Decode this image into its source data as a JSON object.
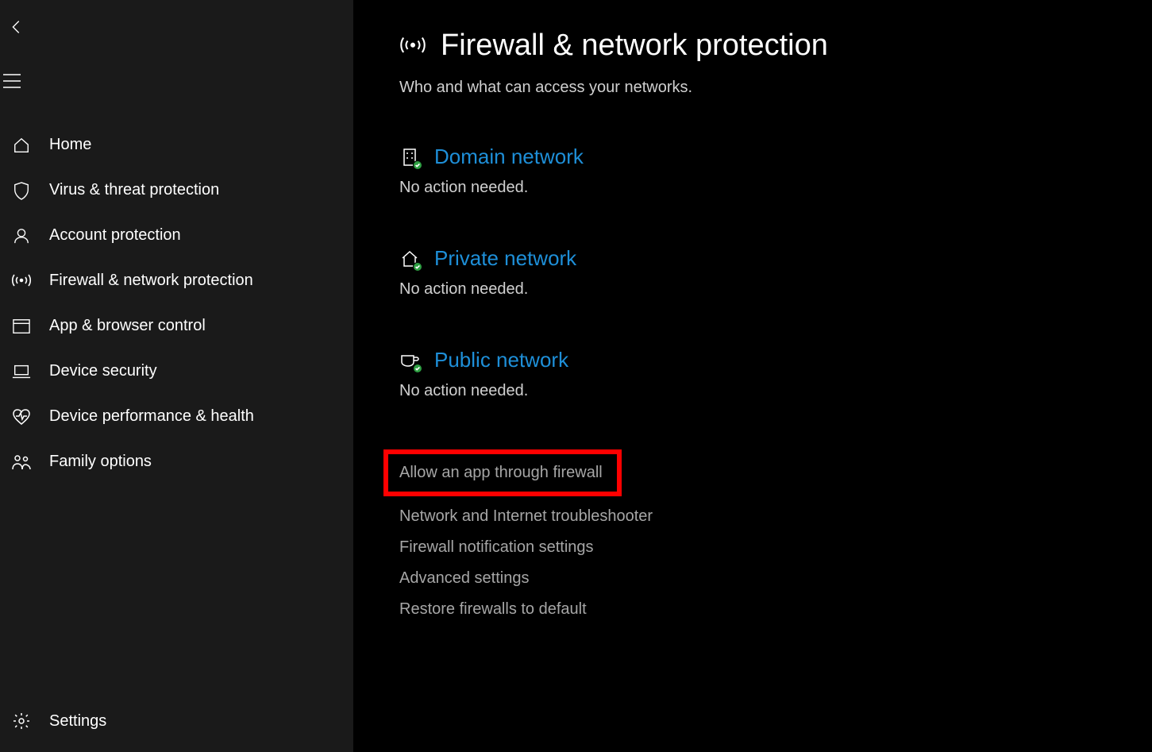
{
  "sidebar": {
    "items": [
      {
        "label": "Home"
      },
      {
        "label": "Virus & threat protection"
      },
      {
        "label": "Account protection"
      },
      {
        "label": "Firewall & network protection"
      },
      {
        "label": "App & browser control"
      },
      {
        "label": "Device security"
      },
      {
        "label": "Device performance & health"
      },
      {
        "label": "Family options"
      }
    ],
    "settings_label": "Settings"
  },
  "page": {
    "title": "Firewall & network protection",
    "subtitle": "Who and what can access your networks."
  },
  "networks": [
    {
      "name": "Domain network",
      "status": "No action needed."
    },
    {
      "name": "Private network",
      "status": "No action needed."
    },
    {
      "name": "Public network",
      "status": "No action needed."
    }
  ],
  "actions": {
    "allow_app": "Allow an app through firewall",
    "troubleshooter": "Network and Internet troubleshooter",
    "notification": "Firewall notification settings",
    "advanced": "Advanced settings",
    "restore": "Restore firewalls to default"
  }
}
